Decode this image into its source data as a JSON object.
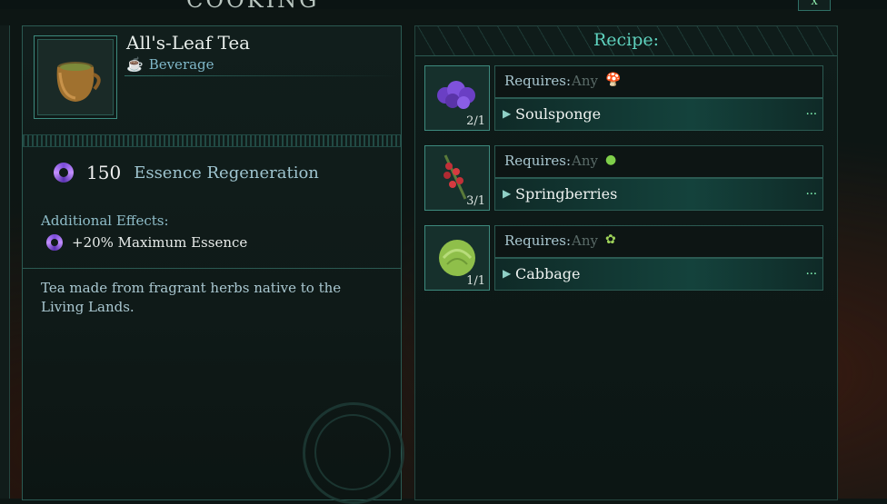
{
  "window": {
    "title": "COOKING",
    "close_label": "X"
  },
  "item": {
    "name": "All's-Leaf Tea",
    "type": "Beverage",
    "type_icon": "cup-icon",
    "stat": {
      "value": "150",
      "label": "Essence Regeneration",
      "icon": "essence-swirl-icon"
    },
    "additional_effects_title": "Additional Effects:",
    "effects": [
      {
        "text": "+20% Maximum Essence",
        "icon": "essence-swirl-icon"
      }
    ],
    "description": "Tea made from fragrant herbs native to the Living Lands."
  },
  "recipe": {
    "title": "Recipe:",
    "ingredients": [
      {
        "requires_label": "Requires:",
        "requires_any": "Any",
        "requires_icon": "mushroom-icon",
        "name": "Soulsponge",
        "count": "2/1",
        "more": "...",
        "color": "#7a4bd6"
      },
      {
        "requires_label": "Requires:",
        "requires_any": "Any",
        "requires_icon": "apple-icon",
        "name": "Springberries",
        "count": "3/1",
        "more": "...",
        "color": "#c0303a"
      },
      {
        "requires_label": "Requires:",
        "requires_any": "Any",
        "requires_icon": "vegetable-icon",
        "name": "Cabbage",
        "count": "1/1",
        "more": "...",
        "color": "#8fbf4a"
      }
    ]
  },
  "colors": {
    "accent": "#5fd3bf",
    "frame": "#2b5a52"
  }
}
